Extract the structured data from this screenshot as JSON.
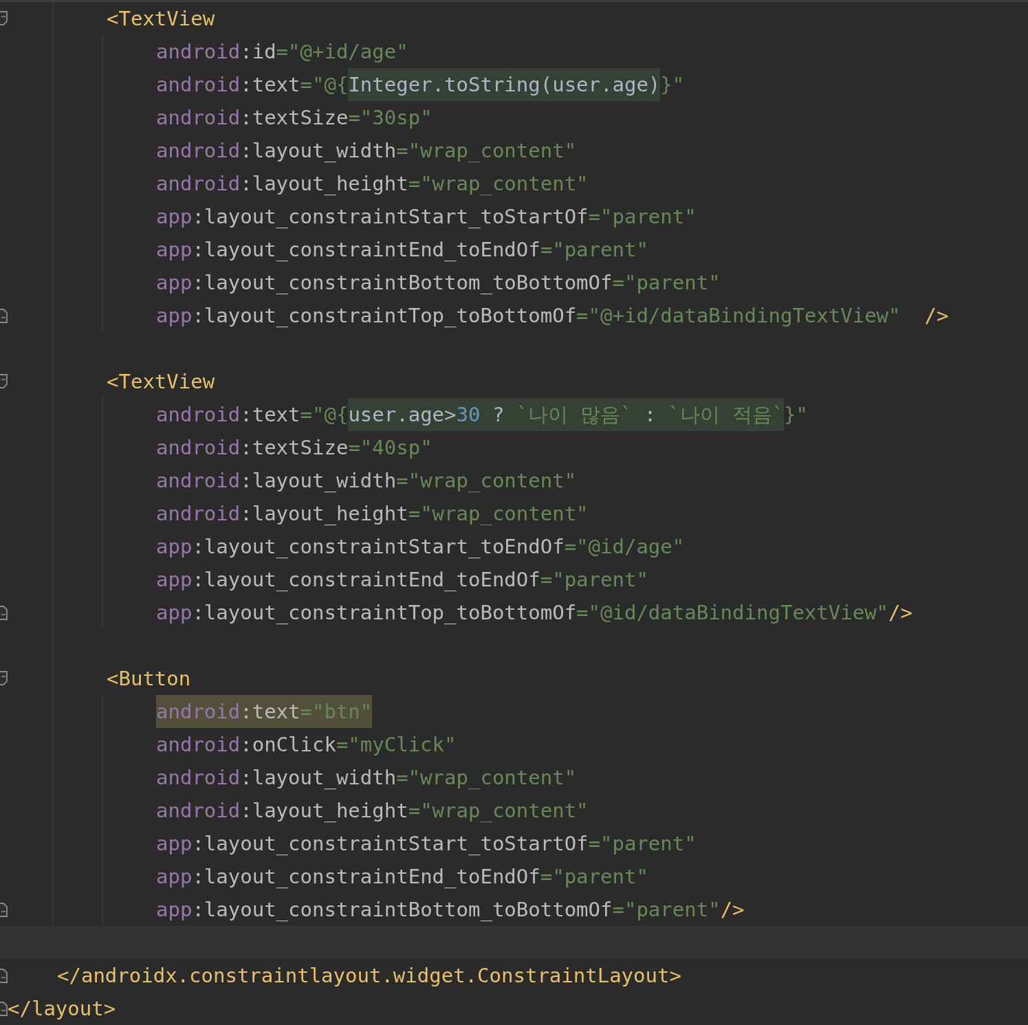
{
  "editor": {
    "lines": [
      {
        "kind": "tag",
        "fold": true,
        "match": false,
        "tokens": [
          {
            "text": "<TextView",
            "kind": "tag"
          }
        ]
      },
      {
        "kind": "attribute",
        "fold": false,
        "match": false,
        "tokens": [
          {
            "text": "android",
            "kind": "namespace"
          },
          {
            "text": ":",
            "kind": "plain"
          },
          {
            "text": "id",
            "kind": "plain"
          },
          {
            "text": "=\"@+id/age\"",
            "kind": "string"
          }
        ]
      },
      {
        "kind": "attribute",
        "fold": false,
        "match": false,
        "tokens": [
          {
            "text": "android",
            "kind": "namespace"
          },
          {
            "text": ":",
            "kind": "plain"
          },
          {
            "text": "text",
            "kind": "plain"
          },
          {
            "text": "=\"@{",
            "kind": "string"
          },
          {
            "kind": "expression",
            "parts": [
              {
                "text": "Integer.toString(user.age)",
                "kind": "code"
              }
            ]
          },
          {
            "text": "}\"",
            "kind": "string"
          }
        ]
      },
      {
        "kind": "attribute",
        "fold": false,
        "match": false,
        "tokens": [
          {
            "text": "android",
            "kind": "namespace"
          },
          {
            "text": ":",
            "kind": "plain"
          },
          {
            "text": "textSize",
            "kind": "plain"
          },
          {
            "text": "=\"30sp\"",
            "kind": "string"
          }
        ]
      },
      {
        "kind": "attribute",
        "fold": false,
        "match": false,
        "tokens": [
          {
            "text": "android",
            "kind": "namespace"
          },
          {
            "text": ":",
            "kind": "plain"
          },
          {
            "text": "layout_width",
            "kind": "plain"
          },
          {
            "text": "=\"wrap_content\"",
            "kind": "string"
          }
        ]
      },
      {
        "kind": "attribute",
        "fold": false,
        "match": false,
        "tokens": [
          {
            "text": "android",
            "kind": "namespace"
          },
          {
            "text": ":",
            "kind": "plain"
          },
          {
            "text": "layout_height",
            "kind": "plain"
          },
          {
            "text": "=\"wrap_content\"",
            "kind": "string"
          }
        ]
      },
      {
        "kind": "attribute",
        "fold": false,
        "match": false,
        "tokens": [
          {
            "text": "app",
            "kind": "namespace"
          },
          {
            "text": ":",
            "kind": "plain"
          },
          {
            "text": "layout_constraintStart_toStartOf",
            "kind": "plain"
          },
          {
            "text": "=\"parent\"",
            "kind": "string"
          }
        ]
      },
      {
        "kind": "attribute",
        "fold": false,
        "match": false,
        "tokens": [
          {
            "text": "app",
            "kind": "namespace"
          },
          {
            "text": ":",
            "kind": "plain"
          },
          {
            "text": "layout_constraintEnd_toEndOf",
            "kind": "plain"
          },
          {
            "text": "=\"parent\"",
            "kind": "string"
          }
        ]
      },
      {
        "kind": "attribute",
        "fold": false,
        "match": false,
        "tokens": [
          {
            "text": "app",
            "kind": "namespace"
          },
          {
            "text": ":",
            "kind": "plain"
          },
          {
            "text": "layout_constraintBottom_toBottomOf",
            "kind": "plain"
          },
          {
            "text": "=\"parent\"",
            "kind": "string"
          }
        ]
      },
      {
        "kind": "attribute",
        "fold": true,
        "match": false,
        "tokens": [
          {
            "text": "app",
            "kind": "namespace"
          },
          {
            "text": ":",
            "kind": "plain"
          },
          {
            "text": "layout_constraintTop_toBottomOf",
            "kind": "plain"
          },
          {
            "text": "=\"@+id/dataBindingTextView\"",
            "kind": "string"
          },
          {
            "text": "  />",
            "kind": "tag"
          }
        ]
      },
      {
        "kind": "blank",
        "fold": false
      },
      {
        "kind": "tag",
        "fold": true,
        "match": false,
        "tokens": [
          {
            "text": "<TextView",
            "kind": "tag"
          }
        ]
      },
      {
        "kind": "attribute",
        "fold": false,
        "match": false,
        "tokens": [
          {
            "text": "android",
            "kind": "namespace"
          },
          {
            "text": ":",
            "kind": "plain"
          },
          {
            "text": "text",
            "kind": "plain"
          },
          {
            "text": "=\"@{",
            "kind": "string"
          },
          {
            "kind": "expression",
            "parts": [
              {
                "text": "user.age>",
                "kind": "code"
              },
              {
                "text": "30",
                "kind": "number"
              },
              {
                "text": " ? ",
                "kind": "code"
              },
              {
                "text": "`나이 많음`",
                "kind": "string"
              },
              {
                "text": " : ",
                "kind": "code"
              },
              {
                "text": "`나이 적음`",
                "kind": "string"
              }
            ]
          },
          {
            "text": "}\"",
            "kind": "string"
          }
        ]
      },
      {
        "kind": "attribute",
        "fold": false,
        "match": false,
        "tokens": [
          {
            "text": "android",
            "kind": "namespace"
          },
          {
            "text": ":",
            "kind": "plain"
          },
          {
            "text": "textSize",
            "kind": "plain"
          },
          {
            "text": "=\"40sp\"",
            "kind": "string"
          }
        ]
      },
      {
        "kind": "attribute",
        "fold": false,
        "match": false,
        "tokens": [
          {
            "text": "android",
            "kind": "namespace"
          },
          {
            "text": ":",
            "kind": "plain"
          },
          {
            "text": "layout_width",
            "kind": "plain"
          },
          {
            "text": "=\"wrap_content\"",
            "kind": "string"
          }
        ]
      },
      {
        "kind": "attribute",
        "fold": false,
        "match": false,
        "tokens": [
          {
            "text": "android",
            "kind": "namespace"
          },
          {
            "text": ":",
            "kind": "plain"
          },
          {
            "text": "layout_height",
            "kind": "plain"
          },
          {
            "text": "=\"wrap_content\"",
            "kind": "string"
          }
        ]
      },
      {
        "kind": "attribute",
        "fold": false,
        "match": false,
        "tokens": [
          {
            "text": "app",
            "kind": "namespace"
          },
          {
            "text": ":",
            "kind": "plain"
          },
          {
            "text": "layout_constraintStart_toEndOf",
            "kind": "plain"
          },
          {
            "text": "=\"@id/age\"",
            "kind": "string"
          }
        ]
      },
      {
        "kind": "attribute",
        "fold": false,
        "match": false,
        "tokens": [
          {
            "text": "app",
            "kind": "namespace"
          },
          {
            "text": ":",
            "kind": "plain"
          },
          {
            "text": "layout_constraintEnd_toEndOf",
            "kind": "plain"
          },
          {
            "text": "=\"parent\"",
            "kind": "string"
          }
        ]
      },
      {
        "kind": "attribute",
        "fold": true,
        "match": false,
        "tokens": [
          {
            "text": "app",
            "kind": "namespace"
          },
          {
            "text": ":",
            "kind": "plain"
          },
          {
            "text": "layout_constraintTop_toBottomOf",
            "kind": "plain"
          },
          {
            "text": "=\"@id/dataBindingTextView\"",
            "kind": "string"
          },
          {
            "text": "/>",
            "kind": "tag"
          }
        ]
      },
      {
        "kind": "blank",
        "fold": false
      },
      {
        "kind": "tag",
        "fold": true,
        "match": false,
        "tokens": [
          {
            "text": "<Button",
            "kind": "tag"
          }
        ]
      },
      {
        "kind": "attribute",
        "fold": false,
        "match": true,
        "tokens": [
          {
            "text": "android",
            "kind": "namespace"
          },
          {
            "text": ":",
            "kind": "plain"
          },
          {
            "text": "text",
            "kind": "plain"
          },
          {
            "text": "=\"btn\"",
            "kind": "string"
          }
        ]
      },
      {
        "kind": "attribute",
        "fold": false,
        "match": false,
        "tokens": [
          {
            "text": "android",
            "kind": "namespace"
          },
          {
            "text": ":",
            "kind": "plain"
          },
          {
            "text": "onClick",
            "kind": "plain"
          },
          {
            "text": "=\"myClick\"",
            "kind": "string"
          }
        ]
      },
      {
        "kind": "attribute",
        "fold": false,
        "match": false,
        "tokens": [
          {
            "text": "android",
            "kind": "namespace"
          },
          {
            "text": ":",
            "kind": "plain"
          },
          {
            "text": "layout_width",
            "kind": "plain"
          },
          {
            "text": "=\"wrap_content\"",
            "kind": "string"
          }
        ]
      },
      {
        "kind": "attribute",
        "fold": false,
        "match": false,
        "tokens": [
          {
            "text": "android",
            "kind": "namespace"
          },
          {
            "text": ":",
            "kind": "plain"
          },
          {
            "text": "layout_height",
            "kind": "plain"
          },
          {
            "text": "=\"wrap_content\"",
            "kind": "string"
          }
        ]
      },
      {
        "kind": "attribute",
        "fold": false,
        "match": false,
        "tokens": [
          {
            "text": "app",
            "kind": "namespace"
          },
          {
            "text": ":",
            "kind": "plain"
          },
          {
            "text": "layout_constraintStart_toStartOf",
            "kind": "plain"
          },
          {
            "text": "=\"parent\"",
            "kind": "string"
          }
        ]
      },
      {
        "kind": "attribute",
        "fold": false,
        "match": false,
        "tokens": [
          {
            "text": "app",
            "kind": "namespace"
          },
          {
            "text": ":",
            "kind": "plain"
          },
          {
            "text": "layout_constraintEnd_toEndOf",
            "kind": "plain"
          },
          {
            "text": "=\"parent\"",
            "kind": "string"
          }
        ]
      },
      {
        "kind": "attribute",
        "fold": true,
        "match": false,
        "tokens": [
          {
            "text": "app",
            "kind": "namespace"
          },
          {
            "text": ":",
            "kind": "plain"
          },
          {
            "text": "layout_constraintBottom_toBottomOf",
            "kind": "plain"
          },
          {
            "text": "=\"parent\"",
            "kind": "string"
          },
          {
            "text": "/>",
            "kind": "tag"
          }
        ]
      },
      {
        "kind": "current",
        "fold": false
      },
      {
        "kind": "outer",
        "fold": true,
        "match": false,
        "tokens": [
          {
            "text": "</androidx.constraintlayout.widget.ConstraintLayout>",
            "kind": "tag"
          }
        ]
      },
      {
        "kind": "root",
        "fold": true,
        "match": false,
        "tokens": [
          {
            "text": "</layout>",
            "kind": "tag"
          }
        ]
      }
    ]
  }
}
